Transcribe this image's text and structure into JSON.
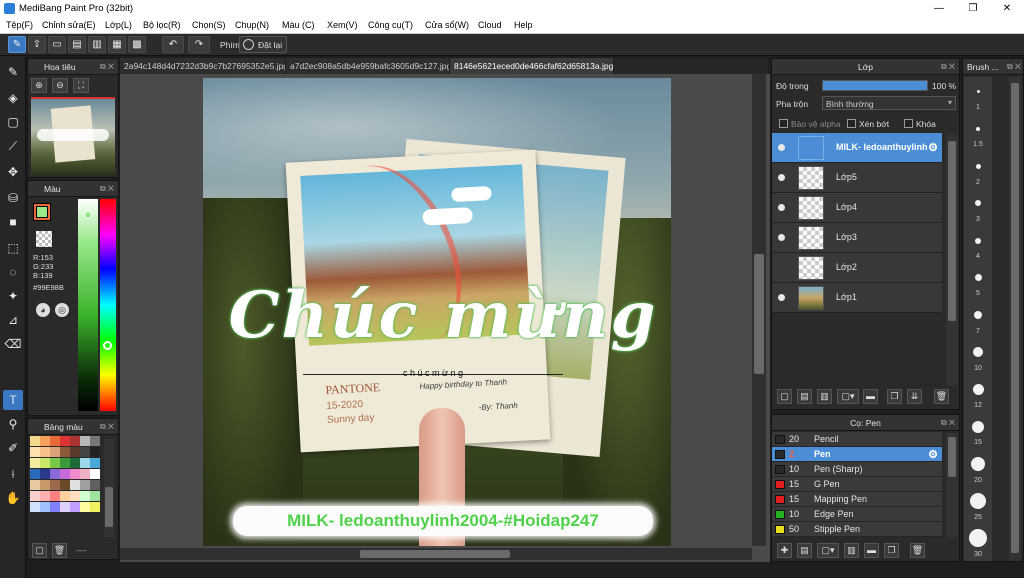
{
  "window": {
    "title": "MediBang Paint Pro (32bit)",
    "minimize": "—",
    "maximize": "❐",
    "close": "✕"
  },
  "menu": [
    "Tệp(F)",
    "Chỉnh sửa(E)",
    "Lớp(L)",
    "Bộ lọc(R)",
    "Chọn(S)",
    "Chụp(N)",
    "Màu (C)",
    "Xem(V)",
    "Công cụ(T)",
    "Cửa sổ(W)",
    "Cloud",
    "Help"
  ],
  "toolbar": {
    "phim_label": "Phím",
    "reset_label": "Đặt lại"
  },
  "navigator": {
    "title": "Hoa tiêu"
  },
  "color": {
    "title": "Màu",
    "rgb_r": "R:153",
    "rgb_g": "G:233",
    "rgb_b": "B:139",
    "hex": "#99E98B",
    "fg": "#e86a3a",
    "fg_inner": "#99e98b"
  },
  "palette": {
    "title": "Bảng màu",
    "footer": "----"
  },
  "tabs": [
    {
      "label": "2a94c148d4d7232d3b9c7b27695352e5.jpg",
      "active": false
    },
    {
      "label": "a7d2ec908a5db4e959bafc3605d9c127.jpg",
      "active": false
    },
    {
      "label": "8146e5621eced0de466cfaf62d65813a.jpg",
      "active": true
    }
  ],
  "canvas": {
    "greeting": "Chúc mừng",
    "watermark": "MILK- ledoanthuylinh2004-#Hoidap247",
    "card_sub": "c h ú c   m ừ n g",
    "pantone": "PANTONE",
    "date": "15-2020",
    "sunny": "Sunny day",
    "birthday": "Happy birthday to  Thanh",
    "by": "-By: Thanh"
  },
  "layers": {
    "title": "Lớp",
    "opacity_label": "Độ trong",
    "opacity_value": "100 %",
    "opacity_fraction": 1.0,
    "blend_label": "Pha trộn",
    "blend_value": "Bình thường",
    "protect_alpha": "Bảo vệ alpha",
    "clip": "Xén bớt",
    "lock": "Khóa",
    "items": [
      {
        "name": "MILK- ledoanthuylinh",
        "selected": true
      },
      {
        "name": "Lớp5",
        "selected": false
      },
      {
        "name": "Lớp4",
        "selected": false
      },
      {
        "name": "Lớp3",
        "selected": false
      },
      {
        "name": "Lớp2",
        "selected": false
      },
      {
        "name": "Lớp1",
        "selected": false
      }
    ]
  },
  "brushes": {
    "title": "Cọ: Pen",
    "items": [
      {
        "size": "20",
        "name": "Pencil",
        "color": "#2a2a2a",
        "selected": false
      },
      {
        "size": "2",
        "name": "Pen",
        "color": "#2a2a2a",
        "selected": true
      },
      {
        "size": "10",
        "name": "Pen (Sharp)",
        "color": "#2a2a2a",
        "selected": false
      },
      {
        "size": "15",
        "name": "G Pen",
        "color": "#e02020",
        "selected": false
      },
      {
        "size": "15",
        "name": "Mapping Pen",
        "color": "#e02020",
        "selected": false
      },
      {
        "size": "10",
        "name": "Edge Pen",
        "color": "#20b020",
        "selected": false
      },
      {
        "size": "50",
        "name": "Stipple Pen",
        "color": "#e8e020",
        "selected": false
      }
    ]
  },
  "brush_size": {
    "title": "Brush ...",
    "sizes": [
      "1",
      "1.5",
      "2",
      "3",
      "4",
      "5",
      "7",
      "10",
      "12",
      "15",
      "20",
      "25",
      "30"
    ]
  }
}
